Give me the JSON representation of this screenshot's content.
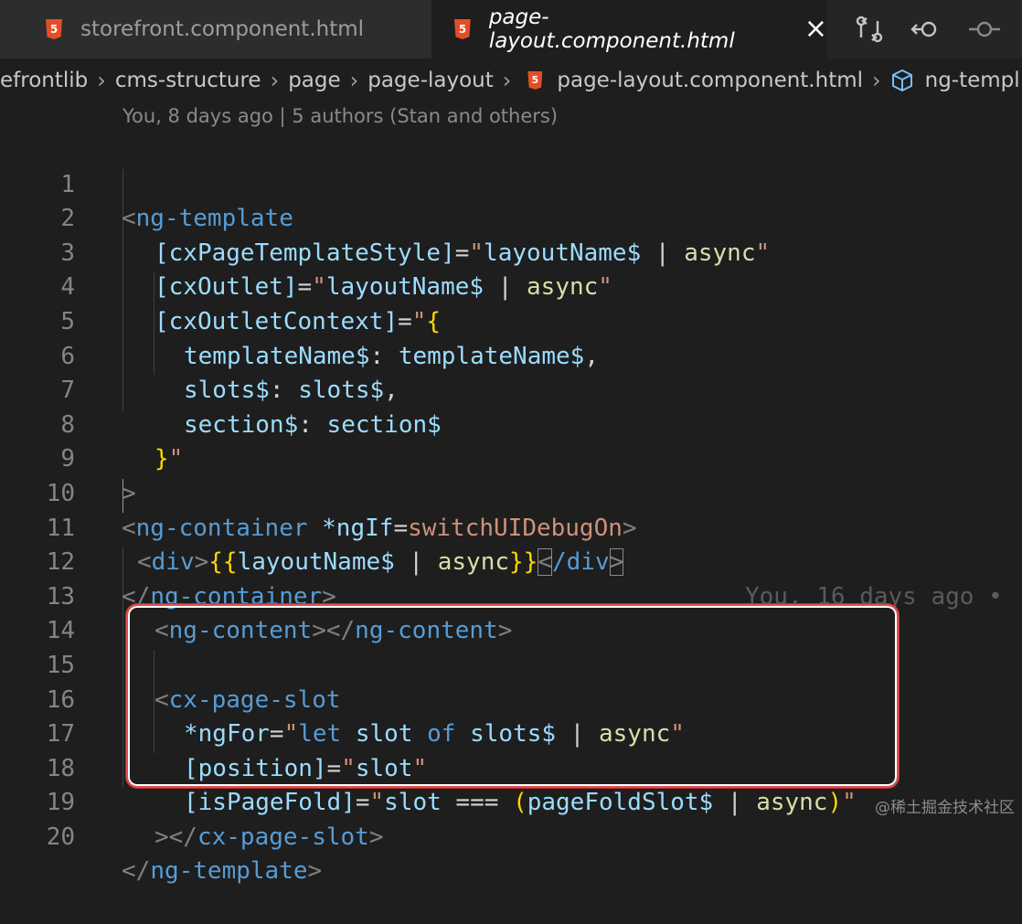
{
  "tabs": [
    {
      "label": "storefront.component.html",
      "icon": "html5-icon",
      "active": false
    },
    {
      "label": "page-layout.component.html",
      "icon": "html5-icon",
      "active": true
    }
  ],
  "tab_icons": [
    "compare-changes-icon",
    "go-back-icon",
    "git-commit-icon"
  ],
  "html_badge": "5",
  "breadcrumb": [
    "efrontlib",
    "cms-structure",
    "page",
    "page-layout",
    "page-layout.component.html",
    "ng-templ"
  ],
  "blame": "You, 8 days ago | 5 authors (Stan and others)",
  "inline_blame": "You, 16 days ago •",
  "line_numbers": [
    "1",
    "2",
    "3",
    "4",
    "5",
    "6",
    "7",
    "8",
    "9",
    "10",
    "11",
    "12",
    "13",
    "14",
    "15",
    "16",
    "17",
    "18",
    "19",
    "20"
  ],
  "code": {
    "l1": [
      "<",
      "ng-template"
    ],
    "l2": [
      "[cxPageTemplateStyle]",
      "=",
      "\"",
      "layoutName$",
      " | ",
      "async",
      "\""
    ],
    "l3": [
      "[cxOutlet]",
      "=",
      "\"",
      "layoutName$",
      " | ",
      "async",
      "\""
    ],
    "l4": [
      "[cxOutletContext]",
      "=",
      "\"",
      "{"
    ],
    "l5": [
      "templateName$",
      ": ",
      "templateName$",
      ","
    ],
    "l6": [
      "slots$",
      ": ",
      "slots$",
      ","
    ],
    "l7": [
      "section$",
      ": ",
      "section$"
    ],
    "l8": [
      "}",
      "\""
    ],
    "l9": [
      ">"
    ],
    "l10": [
      "<",
      "ng-container",
      " ",
      "*ngIf",
      "=",
      "switchUIDebugOn",
      ">"
    ],
    "l11": [
      "<",
      "div",
      ">",
      "{{",
      "layoutName$",
      " | ",
      "async",
      "}}",
      "<",
      "/div",
      ">"
    ],
    "l12": [
      "</",
      "ng-container",
      ">"
    ],
    "l13": [
      "<",
      "ng-content",
      "></",
      "ng-content",
      ">"
    ],
    "l15": [
      "<",
      "cx-page-slot"
    ],
    "l16": [
      "*ngFor",
      "=",
      "\"",
      "let",
      " ",
      "slot",
      " ",
      "of",
      " ",
      "slots$",
      " | ",
      "async",
      "\""
    ],
    "l17": [
      "[position]",
      "=",
      "\"",
      "slot",
      "\""
    ],
    "l18": [
      "[isPageFold]",
      "=",
      "\"",
      "slot",
      " === ",
      "(",
      "pageFoldSlot$",
      " | ",
      "async",
      ")",
      "\""
    ],
    "l19": [
      "></",
      "cx-page-slot",
      ">"
    ],
    "l20": [
      "</",
      "ng-template",
      ">"
    ]
  },
  "watermark": "@稀土掘金技术社区",
  "colors": {
    "editor_bg": "#1e1e1e",
    "tag": "#569cd6",
    "attr": "#9cdcfe",
    "string": "#ce9178",
    "function": "#dcdcaa",
    "bracket_gold": "#ffd700",
    "highlight_box": "#e05050"
  }
}
